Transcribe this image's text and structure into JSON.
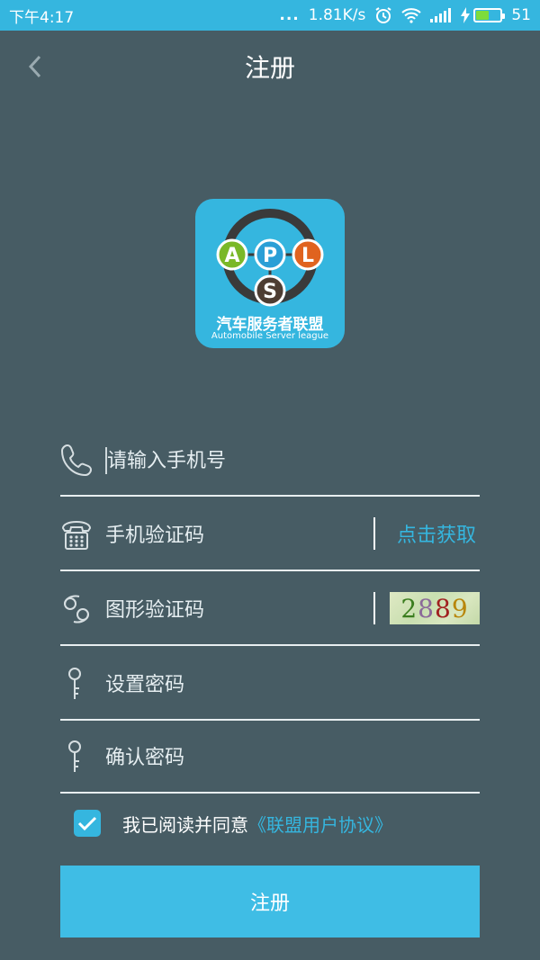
{
  "status_bar": {
    "time": "下午4:17",
    "dots": "...",
    "network_speed": "1.81K/s",
    "battery_level": "51",
    "battery_fraction": 0.51,
    "icons": [
      "alarm-icon",
      "wifi-icon",
      "signal-icon",
      "charging-icon",
      "battery-icon"
    ]
  },
  "header": {
    "title": "注册",
    "back_icon": "chevron-left-icon"
  },
  "logo": {
    "letters": [
      "A",
      "P",
      "L",
      "S"
    ],
    "colors": {
      "A": "#7ab828",
      "P": "#2a9fd6",
      "L": "#e0631f",
      "S": "#4d3d33"
    },
    "name_cn": "汽车服务者联盟",
    "name_en": "Automobile Server league"
  },
  "form": {
    "phone": {
      "placeholder": "请输入手机号",
      "icon": "phone-icon"
    },
    "sms_code": {
      "placeholder": "手机验证码",
      "icon": "telephone-icon",
      "action_label": "点击获取"
    },
    "captcha": {
      "placeholder": "图形验证码",
      "icon": "captcha-icon",
      "image_text": [
        "2",
        "8",
        "8",
        "9"
      ],
      "image_colors": [
        "#3a7d1e",
        "#8b6a9a",
        "#a02020",
        "#b8860b"
      ]
    },
    "password": {
      "placeholder": "设置密码",
      "icon": "key-icon"
    },
    "confirm_password": {
      "placeholder": "确认密码",
      "icon": "key-icon"
    }
  },
  "agreement": {
    "checked": true,
    "text": "我已阅读并同意",
    "link": "《联盟用户协议》"
  },
  "submit": {
    "label": "注册"
  },
  "colors": {
    "accent": "#35b6df",
    "background": "#475c64"
  }
}
